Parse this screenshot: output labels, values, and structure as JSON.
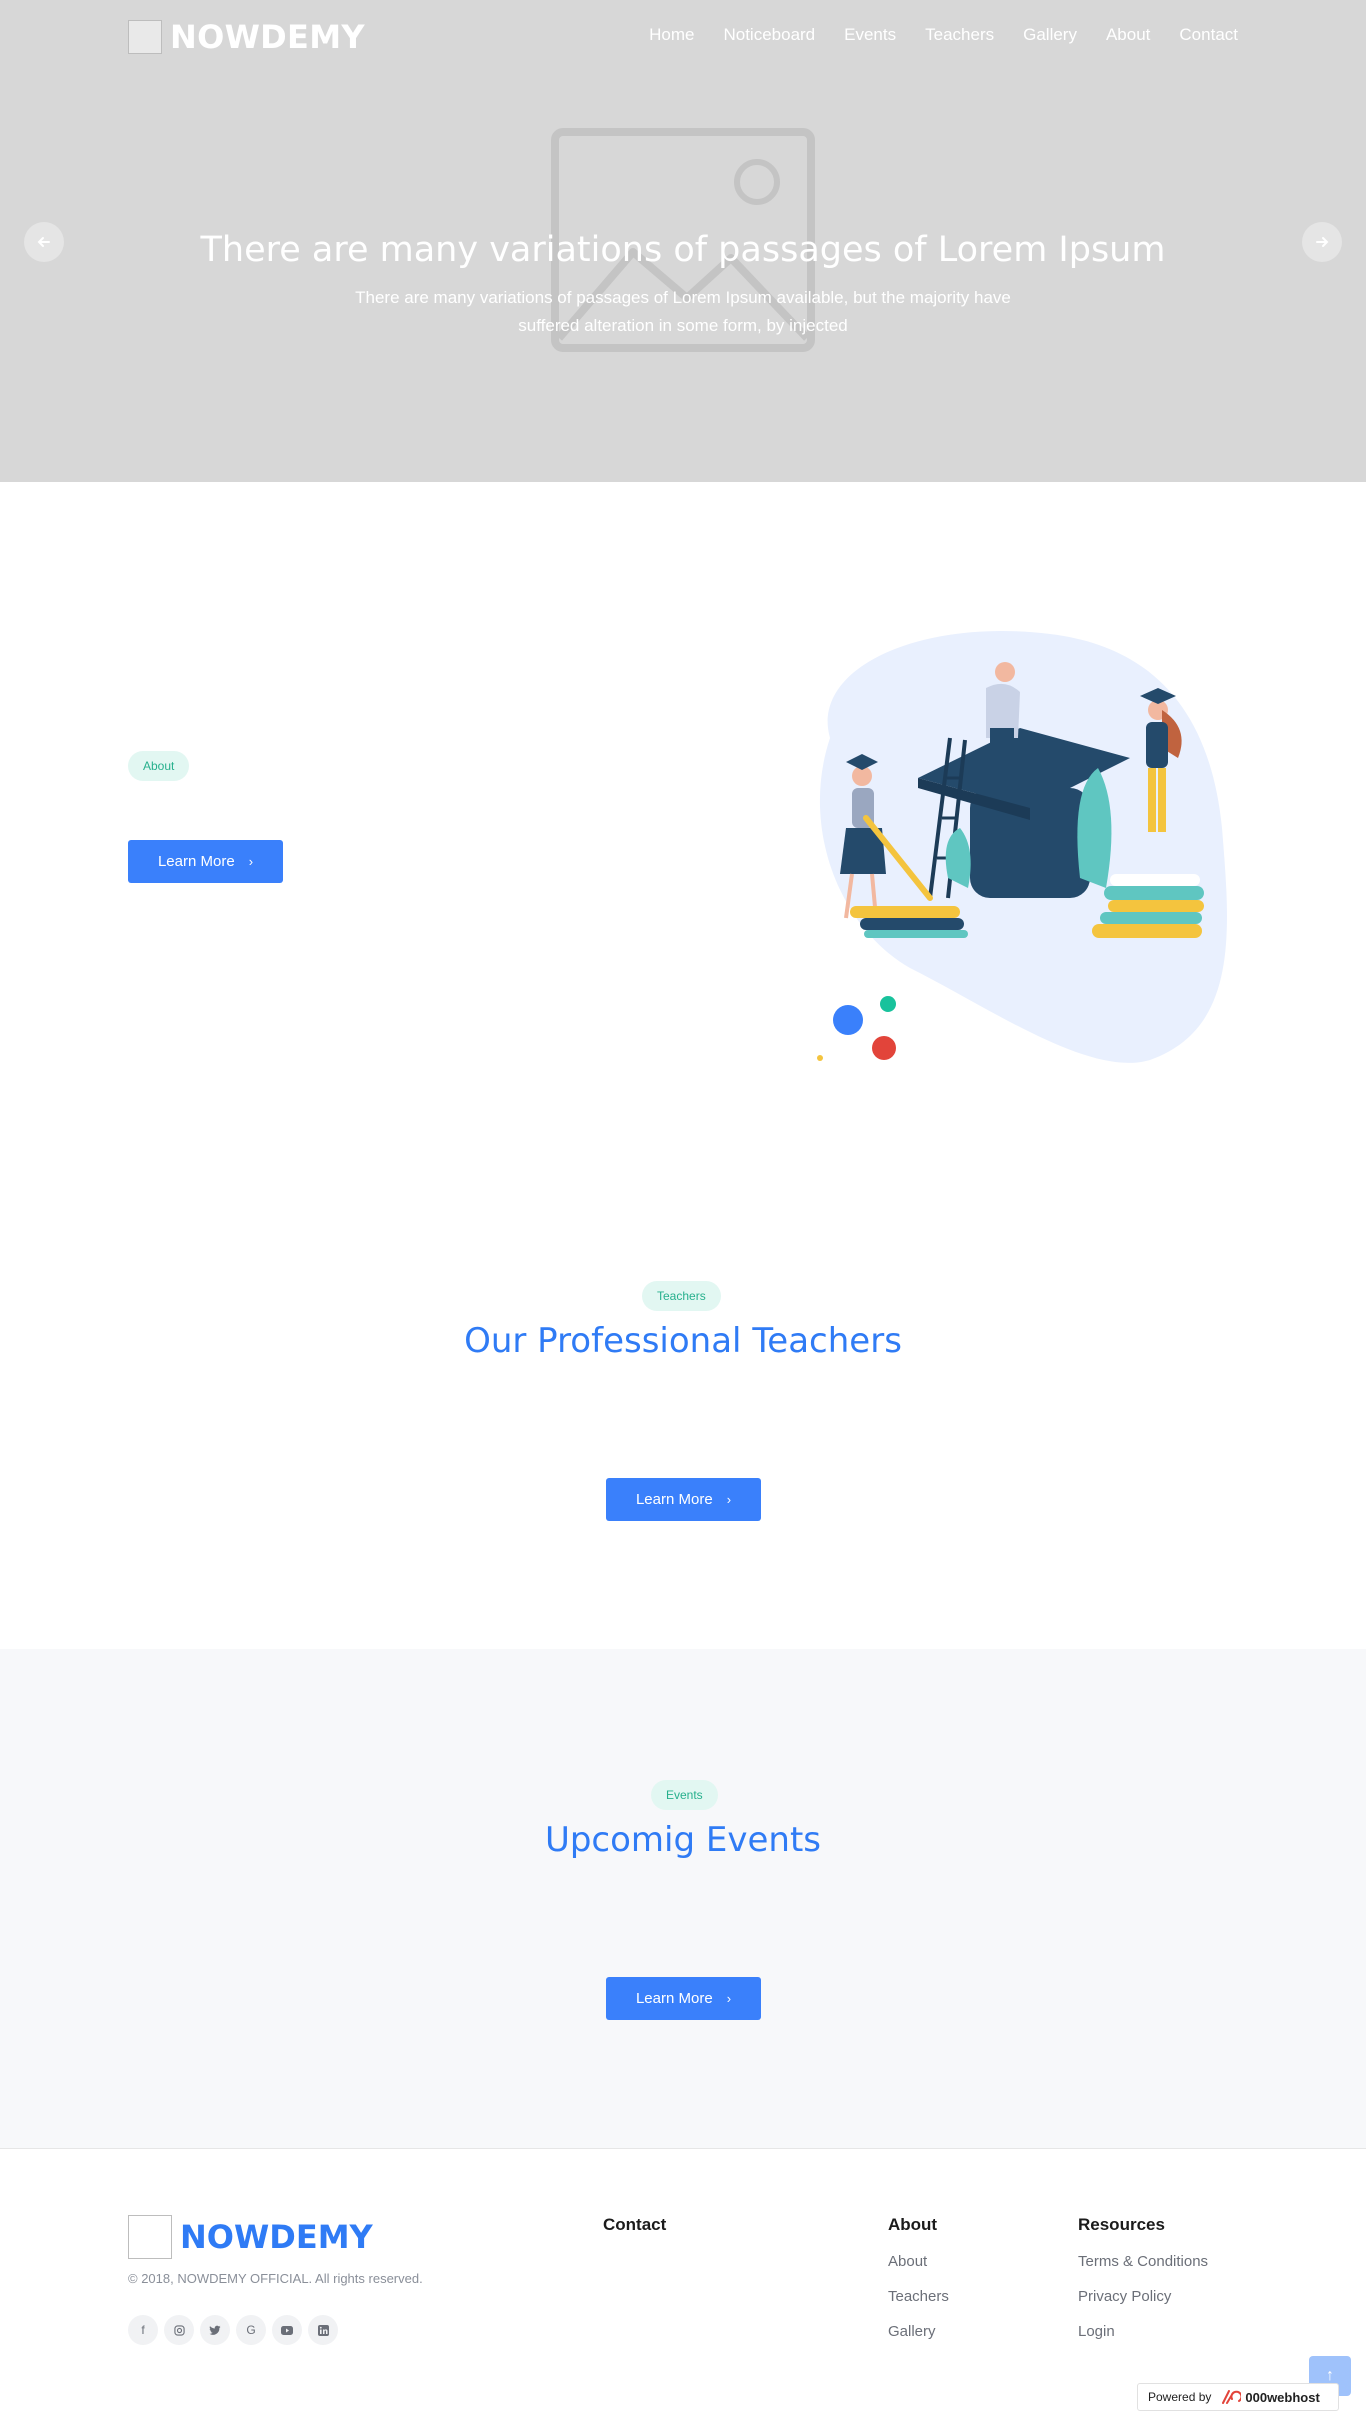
{
  "navbar": {
    "brand": "NOWDEMY",
    "links": [
      "Home",
      "Noticeboard",
      "Events",
      "Teachers",
      "Gallery",
      "About",
      "Contact"
    ]
  },
  "hero": {
    "title": "There are many variations of passages of Lorem Ipsum",
    "description": "There are many variations of passages of Lorem Ipsum available, but the majority have suffered alteration in some form, by injected",
    "prev_icon": "arrow-left-icon",
    "next_icon": "arrow-right-icon"
  },
  "about": {
    "tag": "About",
    "button": "Learn More"
  },
  "teachers": {
    "tag": "Teachers",
    "title": "Our Professional Teachers",
    "button": "Learn More"
  },
  "events": {
    "tag": "Events",
    "title": "Upcomig Events",
    "button": "Learn More"
  },
  "footer": {
    "brand": "NOWDEMY",
    "copyright": "© 2018, NOWDEMY OFFICIAL. All rights reserved.",
    "socials": [
      "facebook-icon",
      "instagram-icon",
      "twitter-icon",
      "google-icon",
      "youtube-icon",
      "linkedin-icon"
    ],
    "contact_title": "Contact",
    "about_title": "About",
    "about_links": [
      "About",
      "Teachers",
      "Gallery"
    ],
    "resources_title": "Resources",
    "resources_links": [
      "Terms & Conditions",
      "Privacy Policy",
      "Login"
    ]
  },
  "widget": {
    "powered_by": "Powered by",
    "host": "000webhost"
  },
  "colors": {
    "primary": "#3a80fb",
    "title_blue": "#2f7bf5",
    "tag_bg": "#e2f7f2",
    "tag_text": "#27b08d",
    "hero_bg": "#d7d7d7"
  }
}
